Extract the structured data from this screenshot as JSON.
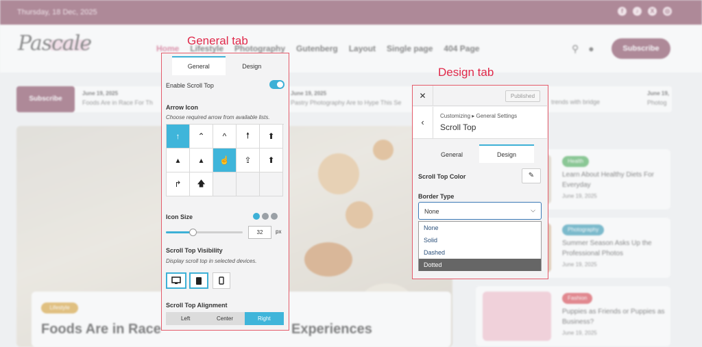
{
  "site": {
    "topbar_date": "Thursday, 18 Dec, 2025",
    "logo_text": "Pascale",
    "nav": [
      "Home",
      "Lifestyle",
      "Photography",
      "Gutenberg",
      "Layout",
      "Single page",
      "404 Page"
    ],
    "subscribe_label": "Subscribe",
    "ticker_subscribe": "Subscribe",
    "ticker": [
      {
        "date": "June 19, 2025",
        "title": "Foods Are in Race For Th"
      },
      {
        "date": "June 19, 2025",
        "title": "Pastry Photography Are to Hype This Se"
      },
      {
        "date": "",
        "title": "trends with bridge"
      },
      {
        "date": "June 19,",
        "title": "Photog"
      }
    ],
    "hero_tag": "Lifestyle",
    "hero_title_left": "Foods Are in Race",
    "hero_title_right": "Experiences",
    "side_posts": [
      {
        "tag": "Health",
        "title": "Learn About Healthy Diets For Everyday",
        "date": "June 19, 2025",
        "tag_color": "#3aa64a"
      },
      {
        "tag": "Photography",
        "title": "Summer Season Asks Up the Professional Photos",
        "date": "June 19, 2025",
        "tag_color": "#1f8fae"
      },
      {
        "tag": "Fashion",
        "title": "Puppies as Friends or Puppies as Business?",
        "date": "June 19, 2025",
        "tag_color": "#d8343f"
      }
    ]
  },
  "annotations": {
    "general": "General tab",
    "design": "Design tab"
  },
  "general_panel": {
    "tabs": [
      "General",
      "Design"
    ],
    "enable_label": "Enable Scroll Top",
    "enable_on": true,
    "arrow_icon_label": "Arrow Icon",
    "arrow_icon_hint": "Choose required arrow from available lists.",
    "icons": [
      "arrow-up-icon",
      "chevron-up-thin-icon",
      "chevron-up-icon",
      "arrow-up-bold-icon",
      "circle-arrow-up-icon",
      "caret-up-small-icon",
      "caret-up-icon",
      "hand-pointer-icon",
      "upload-icon",
      "circle-arrow-up-filled-icon",
      "arrow-turn-up-icon",
      "arrow-up-thick-icon"
    ],
    "icon_glyphs": [
      "↑",
      "⌃",
      "^",
      "🠕",
      "⬆",
      "▴",
      "▴",
      "☝",
      "⇪",
      "⬆",
      "↱",
      "🡅"
    ],
    "selected_icons": [
      0,
      7
    ],
    "icon_size_label": "Icon Size",
    "icon_size_value": "32",
    "icon_size_unit": "px",
    "icon_size_fraction": 0.35,
    "visibility_label": "Scroll Top Visibility",
    "visibility_hint": "Display scroll top in selected devices.",
    "alignment_label": "Scroll Top Alignment",
    "alignment_options": [
      "Left",
      "Center",
      "Right"
    ],
    "alignment_selected": "Right",
    "accent_color": "#3fb5da"
  },
  "design_panel": {
    "close_glyph": "✕",
    "published_label": "Published",
    "breadcrumb": "Customizing ▸ General Settings",
    "title": "Scroll Top",
    "tabs": [
      "General",
      "Design"
    ],
    "color_label": "Scroll Top Color",
    "border_type_label": "Border Type",
    "border_type_value": "None",
    "border_options": [
      "None",
      "Solid",
      "Dashed",
      "Dotted"
    ],
    "highlighted_option": "Dotted"
  }
}
